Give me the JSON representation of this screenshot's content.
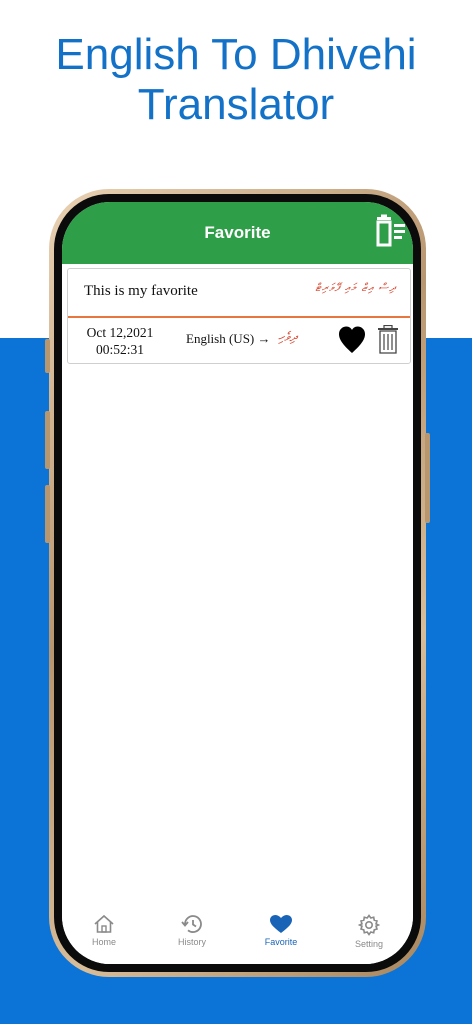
{
  "promo": {
    "title_line1": "English To Dhivehi",
    "title_line2": "Translator"
  },
  "colors": {
    "promo_blue": "#0c74d6",
    "header_green": "#2f9e48",
    "accent_orange": "#e8773f",
    "active_tab": "#1a64b7"
  },
  "header": {
    "title": "Favorite",
    "clear_all_icon": "trash-list-icon"
  },
  "favorites": [
    {
      "source_text": "This is my favorite",
      "translated_text": "ދިސް އިޒް މައި ފޭވަރިޓް",
      "date": "Oct 12,2021",
      "time": "00:52:31",
      "source_lang": "English (US) →",
      "target_lang": "ދިވެހި",
      "favorite_icon": "heart-icon",
      "delete_icon": "trash-icon"
    }
  ],
  "tabs": [
    {
      "label": "Home",
      "icon": "home-icon"
    },
    {
      "label": "History",
      "icon": "history-icon"
    },
    {
      "label": "Favorite",
      "icon": "heart-icon",
      "active": true
    },
    {
      "label": "Setting",
      "icon": "gear-icon"
    }
  ]
}
